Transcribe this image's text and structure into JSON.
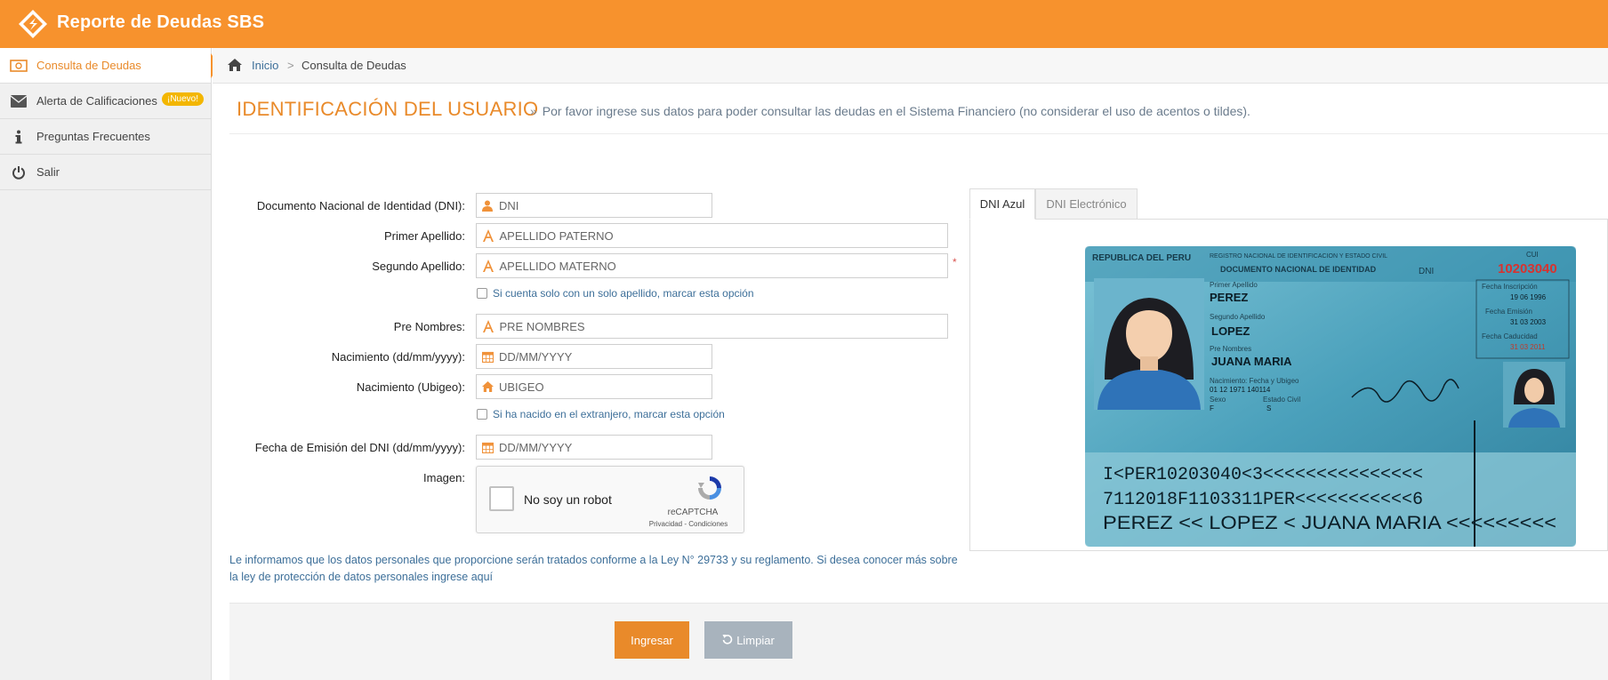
{
  "app": {
    "title": "Reporte de Deudas SBS"
  },
  "sidebar": {
    "items": [
      {
        "label": "Consulta de Deudas",
        "icon": "money-icon",
        "active": true
      },
      {
        "label": "Alerta de Calificaciones",
        "icon": "envelope-icon",
        "badge": "¡Nuevo!"
      },
      {
        "label": "Preguntas Frecuentes",
        "icon": "info-icon"
      },
      {
        "label": "Salir",
        "icon": "power-icon"
      }
    ]
  },
  "breadcrumb": {
    "home": "Inicio",
    "separator": ">",
    "current": "Consulta de Deudas"
  },
  "header": {
    "title": "IDENTIFICACIÓN DEL USUARIO",
    "subtitle_prefix": "»",
    "subtitle": "Por favor ingrese sus datos para poder consultar las deudas en el Sistema Financiero (no considerar el uso de acentos o tildes)."
  },
  "form": {
    "dni": {
      "label": "Documento Nacional de Identidad (DNI):",
      "placeholder": "DNI"
    },
    "primer_apellido": {
      "label": "Primer Apellido:",
      "placeholder": "APELLIDO PATERNO"
    },
    "segundo_apellido": {
      "label": "Segundo Apellido:",
      "placeholder": "APELLIDO MATERNO",
      "required_mark": "*"
    },
    "solo_apellido": {
      "label": "Si cuenta solo con un solo apellido, marcar esta opción"
    },
    "pre_nombres": {
      "label": "Pre Nombres:",
      "placeholder": "PRE NOMBRES"
    },
    "nacimiento_fecha": {
      "label": "Nacimiento (dd/mm/yyyy):",
      "placeholder": "DD/MM/YYYY"
    },
    "nacimiento_ubigeo": {
      "label": "Nacimiento (Ubigeo):",
      "placeholder": "UBIGEO"
    },
    "extranjero": {
      "label": "Si ha nacido en el extranjero, marcar esta opción"
    },
    "fecha_emision": {
      "label": "Fecha de Emisión del DNI (dd/mm/yyyy):",
      "placeholder": "DD/MM/YYYY"
    },
    "imagen": {
      "label": "Imagen:"
    }
  },
  "captcha": {
    "text": "No soy un robot",
    "brand": "reCAPTCHA",
    "terms": "Privacidad - Condiciones"
  },
  "privacy_notice": "Le informamos que los datos personales que proporcione serán tratados conforme a la Ley N° 29733 y su reglamento. Si desea conocer más sobre la ley de protección de datos personales ingrese aquí",
  "buttons": {
    "submit": "Ingresar",
    "clear": "Limpiar"
  },
  "tabs": [
    {
      "label": "DNI Azul",
      "active": true
    },
    {
      "label": "DNI Electrónico",
      "active": false
    }
  ],
  "dni_card": {
    "header_left": "REPUBLICA DEL PERU",
    "header_registry": "REGISTRO NACIONAL DE IDENTIFICACION Y ESTADO CIVIL",
    "header_doc": "DOCUMENTO NACIONAL DE IDENTIDAD",
    "dni_label": "DNI",
    "cui_label": "CUI",
    "dni_number": "10203040",
    "side_code": "10203040",
    "primer_apellido_label": "Primer Apellido",
    "primer_apellido": "PEREZ",
    "segundo_apellido_label": "Segundo Apellido",
    "segundo_apellido": "LOPEZ",
    "pre_nombres_label": "Pre Nombres",
    "pre_nombres": "JUANA MARIA",
    "nacimiento_label": "Nacimiento: Fecha y Ubigeo",
    "nacimiento": "01 12 1971     140114",
    "sexo_label": "Sexo",
    "sexo": "F",
    "estado_civil_label": "Estado Civil",
    "estado_civil": "S",
    "inscripcion_label": "Fecha Inscripción",
    "inscripcion": "19 06 1996",
    "emision_label": "Fecha Emisión",
    "emision": "31 03 2003",
    "caducidad_label": "Fecha Caducidad",
    "caducidad": "31 03 2011",
    "mrz1": "I<PER10203040<3<<<<<<<<<<<<<<<",
    "mrz2": "7112018F1103311PER<<<<<<<<<<<6",
    "mrz3": "PEREZ << LOPEZ < JUANA MARIA <<<<<<<<<"
  },
  "colors": {
    "brand": "#f7922d",
    "accent": "#e98a2a",
    "link": "#3d6f99",
    "secondary_button": "#a8b3bd"
  }
}
